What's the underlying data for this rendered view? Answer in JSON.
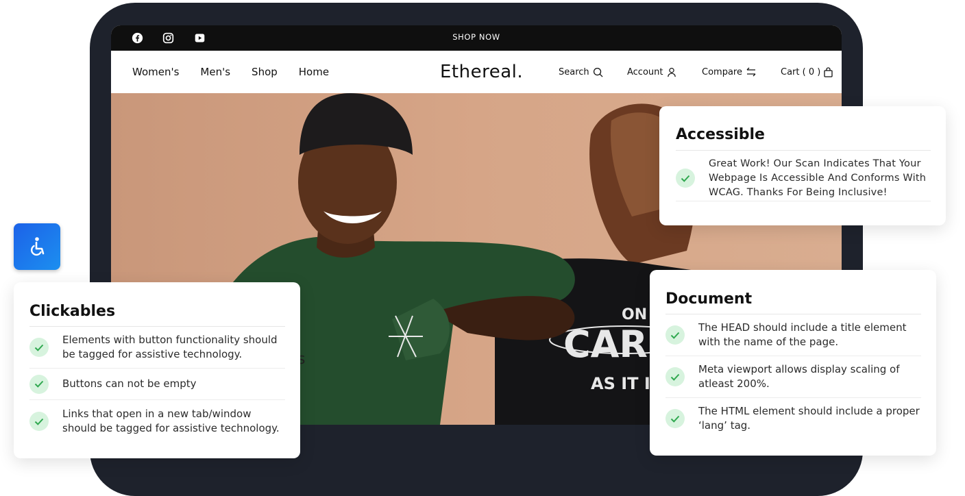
{
  "topbar": {
    "announcement": "SHOP NOW",
    "social_icons": [
      "facebook-icon",
      "instagram-icon",
      "youtube-icon"
    ]
  },
  "nav": {
    "left_links": [
      "Women's",
      "Men's",
      "Shop",
      "Home"
    ],
    "brand": "Ethereal.",
    "search_label": "Search",
    "account_label": "Account",
    "compare_label": "Compare",
    "cart_label": "Cart ( 0 )"
  },
  "hero": {
    "shirt_text_1": "ON",
    "shirt_text_2": "CAR",
    "shirt_text_3": "AS IT IS",
    "partial_text": "s"
  },
  "accessibility_button": {
    "icon": "wheelchair-icon"
  },
  "cards": {
    "accessible": {
      "title": "Accessible",
      "items": [
        "Great Work! Our Scan Indicates That Your Webpage Is Accessible And Conforms With WCAG. Thanks For Being Inclusive!"
      ]
    },
    "clickables": {
      "title": "Clickables",
      "items": [
        "Elements with button functionality should be tagged for assistive technology.",
        "Buttons can not be empty",
        "Links that open in a new tab/window should be tagged for assistive technology."
      ]
    },
    "document": {
      "title": "Document",
      "items": [
        "The HEAD should include a title element with the name of the page.",
        "Meta viewport allows display scaling of atleast 200%.",
        "The HTML element should include a proper ‘lang’ tag."
      ]
    }
  },
  "colors": {
    "frame": "#1e222c",
    "topbar": "#0f0f0f",
    "hero_bg": "#d6a587",
    "check_bg": "#d7f3de",
    "check_mark": "#2fa84f",
    "a11y_blue": "#1c62e8"
  }
}
